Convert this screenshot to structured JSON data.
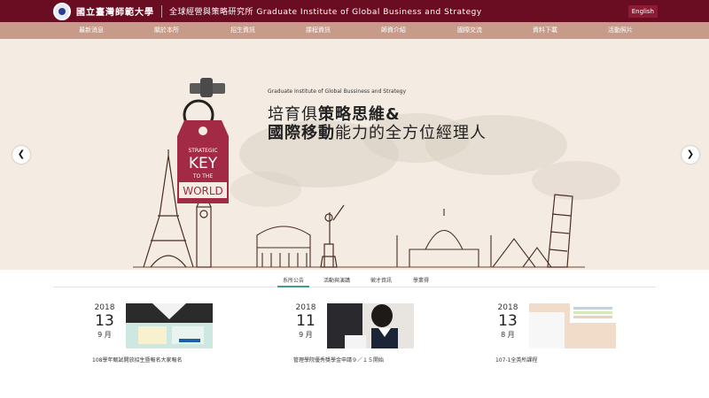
{
  "header": {
    "logo_text": "國立臺灣師範大學",
    "institute_name": "全球經營與策略研究所 Graduate Institute of Global Business and Strategy",
    "language_button": "English"
  },
  "nav": {
    "items": [
      "最新消息",
      "關於本所",
      "招生資訊",
      "課程資訊",
      "師資介紹",
      "國際交流",
      "資料下載",
      "活動照片"
    ]
  },
  "hero": {
    "subtitle": "Graduate Institute of Global Bussiness and Strategy",
    "line1_a": "培育俱",
    "line1_b": "策略思維&",
    "line2_a": "國際移動",
    "line2_b": "能力的全方位經理人",
    "tag_small": "STRATEGIC",
    "tag_big1": "KEY",
    "tag_small2": "TO THE",
    "tag_big2": "WORLD",
    "prev_icon": "chevron-left-icon",
    "next_icon": "chevron-right-icon"
  },
  "tabs": {
    "items": [
      "系所公告",
      "活動與演講",
      "徵才資訊",
      "學業得"
    ],
    "active": 0
  },
  "news": [
    {
      "year": "2018",
      "day": "13",
      "month": "9 月",
      "title": "108學年甄試開放招生暨報名大家報名"
    },
    {
      "year": "2018",
      "day": "11",
      "month": "9 月",
      "title": "管理學院優秀獎學金申請９／１５開始"
    },
    {
      "year": "2018",
      "day": "13",
      "month": "8 月",
      "title": "107-1全英所課程"
    }
  ],
  "colors": {
    "header_bg": "#6b0d22",
    "nav_bg": "#c79a89",
    "hero_bg": "#f4ece3",
    "accent": "#3aa08a",
    "tag_red": "#a32a44"
  }
}
